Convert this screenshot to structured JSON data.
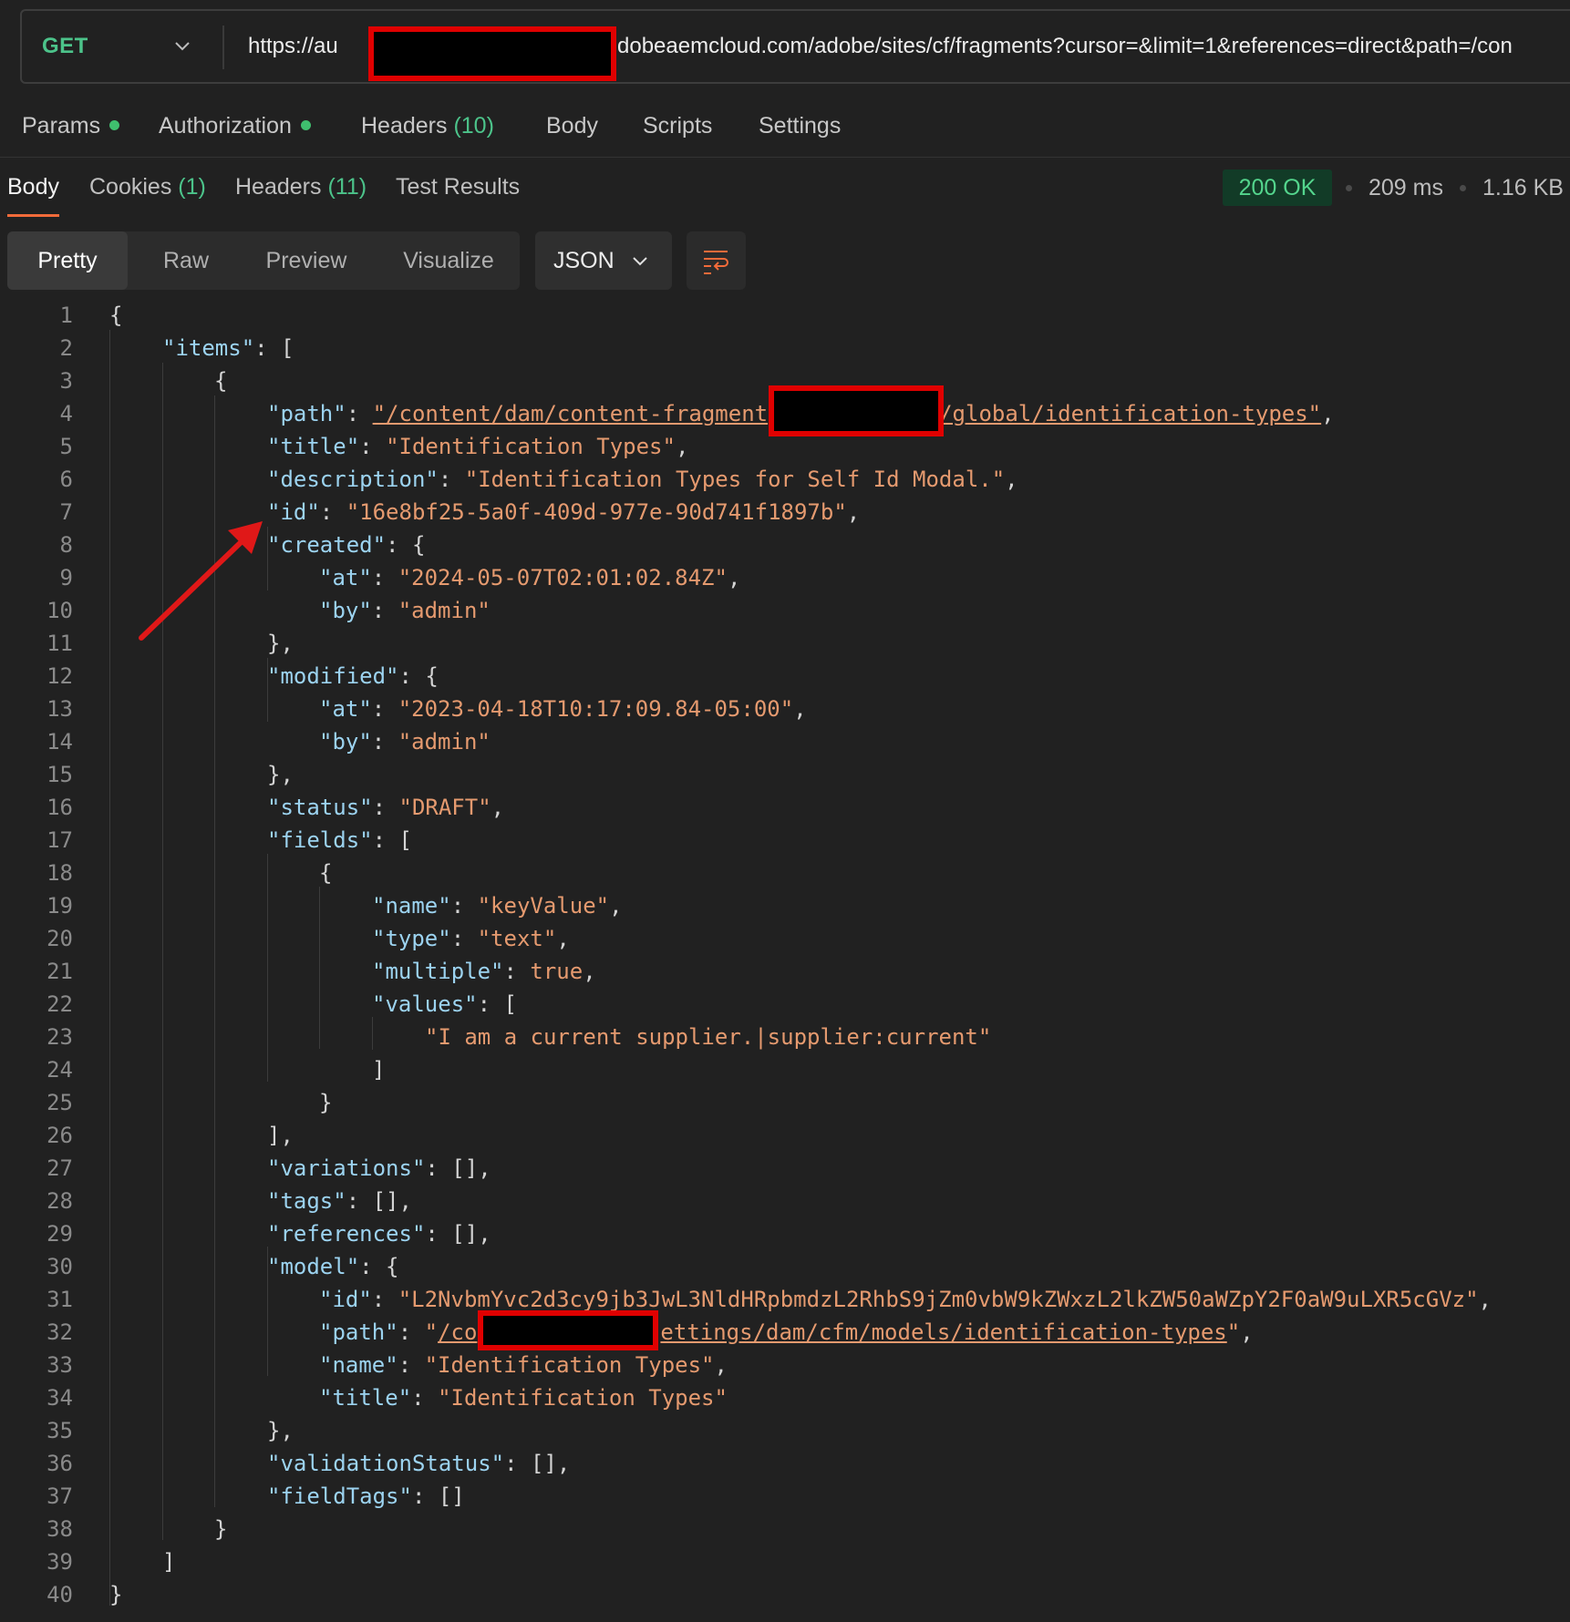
{
  "request": {
    "method": "GET",
    "url_part1": "https://au",
    "url_part2": "dobeaemcloud.com/adobe/sites/cf/fragments?cursor=&limit=1&references=direct&path=/con"
  },
  "request_tabs": {
    "params": "Params",
    "authorization": "Authorization",
    "headers_label": "Headers",
    "headers_count": "(10)",
    "body": "Body",
    "scripts": "Scripts",
    "settings": "Settings"
  },
  "response_tabs": {
    "body": "Body",
    "cookies_label": "Cookies",
    "cookies_count": "(1)",
    "headers_label": "Headers",
    "headers_count": "(11)",
    "test_results": "Test Results"
  },
  "response_meta": {
    "status": "200 OK",
    "time": "209 ms",
    "size": "1.16 KB"
  },
  "view_modes": {
    "pretty": "Pretty",
    "raw": "Raw",
    "preview": "Preview",
    "visualize": "Visualize",
    "format": "JSON"
  },
  "colors": {
    "background": "#212121",
    "key": "#9cd3f0",
    "string": "#e59a6f",
    "status_ok": "#54d58d",
    "active_tab": "#f26b3a",
    "redaction_border": "#e00000"
  },
  "code": {
    "l1": "{",
    "l2_k": "\"items\"",
    "l2_p": ": [",
    "l3": "{",
    "l4_k": "\"path\"",
    "l4_a": ": ",
    "l4_s1": "\"/content/dam/content-fragment",
    "l4_s2": "/global/identification-types\"",
    "l4_c": ",",
    "l5_k": "\"title\"",
    "l5_a": ": ",
    "l5_s": "\"Identification Types\"",
    "l5_c": ",",
    "l6_k": "\"description\"",
    "l6_a": ": ",
    "l6_s": "\"Identification Types for Self Id Modal.\"",
    "l6_c": ",",
    "l7_k": "\"id\"",
    "l7_a": ": ",
    "l7_s": "\"16e8bf25-5a0f-409d-977e-90d741f1897b\"",
    "l7_c": ",",
    "l8_k": "\"created\"",
    "l8_p": ": {",
    "l9_k": "\"at\"",
    "l9_a": ": ",
    "l9_s": "\"2024-05-07T02:01:02.84Z\"",
    "l9_c": ",",
    "l10_k": "\"by\"",
    "l10_a": ": ",
    "l10_s": "\"admin\"",
    "l11": "},",
    "l12_k": "\"modified\"",
    "l12_p": ": {",
    "l13_k": "\"at\"",
    "l13_a": ": ",
    "l13_s": "\"2023-04-18T10:17:09.84-05:00\"",
    "l13_c": ",",
    "l14_k": "\"by\"",
    "l14_a": ": ",
    "l14_s": "\"admin\"",
    "l15": "},",
    "l16_k": "\"status\"",
    "l16_a": ": ",
    "l16_s": "\"DRAFT\"",
    "l16_c": ",",
    "l17_k": "\"fields\"",
    "l17_p": ": [",
    "l18": "{",
    "l19_k": "\"name\"",
    "l19_a": ": ",
    "l19_s": "\"keyValue\"",
    "l19_c": ",",
    "l20_k": "\"type\"",
    "l20_a": ": ",
    "l20_s": "\"text\"",
    "l20_c": ",",
    "l21_k": "\"multiple\"",
    "l21_a": ": ",
    "l21_s": "true",
    "l21_c": ",",
    "l22_k": "\"values\"",
    "l22_p": ": [",
    "l23_s": "\"I am a current supplier.|supplier:current\"",
    "l24": "]",
    "l25": "}",
    "l26": "],",
    "l27_k": "\"variations\"",
    "l27_p": ": [],",
    "l28_k": "\"tags\"",
    "l28_p": ": [],",
    "l29_k": "\"references\"",
    "l29_p": ": [],",
    "l30_k": "\"model\"",
    "l30_p": ": {",
    "l31_k": "\"id\"",
    "l31_a": ": ",
    "l31_s": "\"L2NvbmYvc2d3cy9jb3JwL3NldHRpbmdzL2RhbS9jZm0vbW9kZWxzL2lkZW50aWZpY2F0aW9uLXR5cGVz\"",
    "l31_c": ",",
    "l32_k": "\"path\"",
    "l32_a": ": ",
    "l32_s0": "\"",
    "l32_s1": "/co",
    "l32_s2": "ettings/dam/cfm/models/identification-types",
    "l32_s3": "\"",
    "l32_c": ",",
    "l33_k": "\"name\"",
    "l33_a": ": ",
    "l33_s": "\"Identification Types\"",
    "l33_c": ",",
    "l34_k": "\"title\"",
    "l34_a": ": ",
    "l34_s": "\"Identification Types\"",
    "l35": "},",
    "l36_k": "\"validationStatus\"",
    "l36_p": ": [],",
    "l37_k": "\"fieldTags\"",
    "l37_p": ": []",
    "l38": "}",
    "l39": "]",
    "l40": "}"
  }
}
